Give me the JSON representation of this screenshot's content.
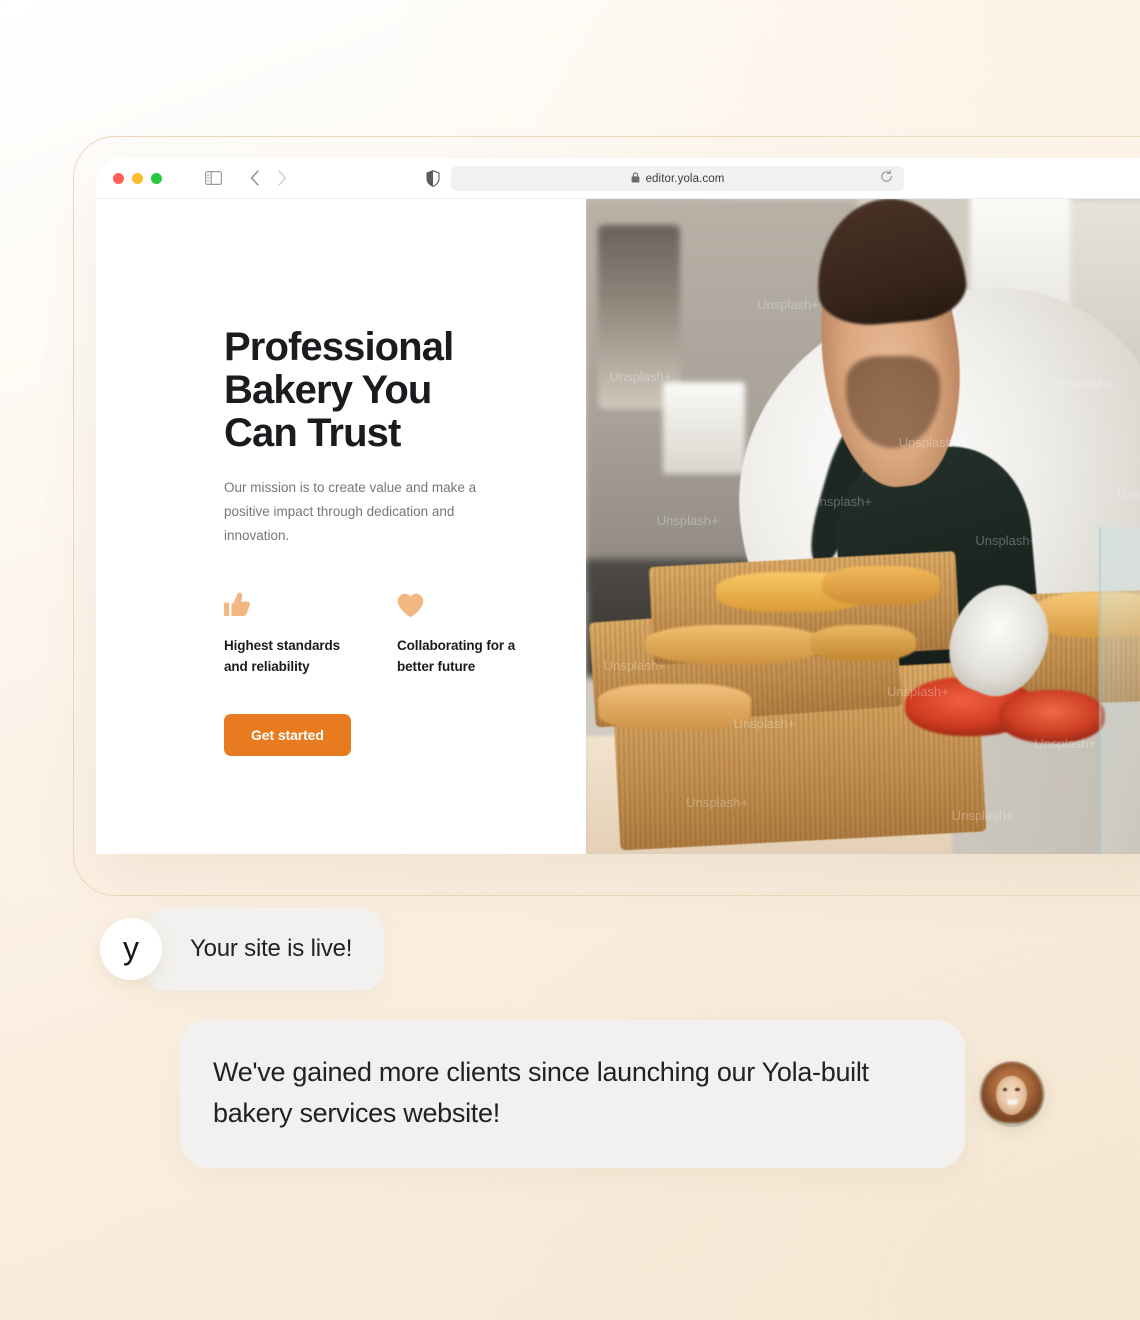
{
  "browser": {
    "url": "editor.yola.com",
    "lock_icon": "lock-icon",
    "reload_icon": "reload-icon",
    "shield_icon": "shield-icon",
    "sidebar_icon": "sidebar-toggle-icon",
    "back_icon": "chevron-left-icon",
    "forward_icon": "chevron-right-icon",
    "traffic_lights": {
      "close": "#ff5f57",
      "minimize": "#febc2e",
      "maximize": "#28c840"
    }
  },
  "hero": {
    "title": "Professional Bakery You Can Trust",
    "subtitle": "Our mission is to create value and make a positive impact through dedication and innovation.",
    "features": [
      {
        "icon": "thumbs-up-icon",
        "label": "Highest standards and reliability"
      },
      {
        "icon": "heart-icon",
        "label": "Collaborating for a better future"
      }
    ],
    "cta_label": "Get started",
    "accent_color": "#e87b20",
    "icon_color": "#f3b784",
    "photo_alt": "Baker in white shirt and dark apron arranging baskets of pastries",
    "photo_watermark": "Unsplash+"
  },
  "chat": {
    "messages": [
      {
        "avatar_type": "brand-logo",
        "avatar_text": "y",
        "text": "Your site is live!"
      },
      {
        "avatar_type": "user-photo",
        "text": "We've gained more clients since launching our Yola-built bakery services website!"
      }
    ]
  }
}
